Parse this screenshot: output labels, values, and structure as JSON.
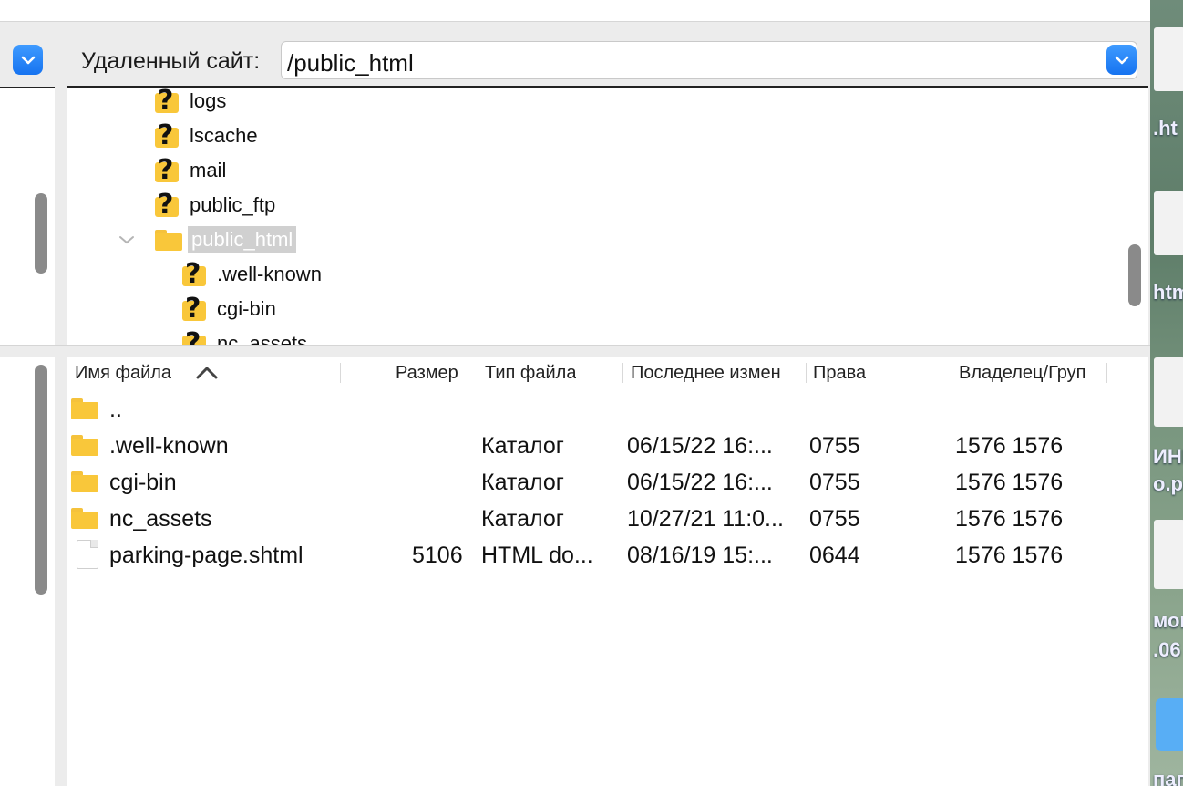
{
  "remote": {
    "site_label": "Удаленный сайт:",
    "path": "/public_html"
  },
  "tree": {
    "items": [
      {
        "label": "logs",
        "icon": "unknown-folder-icon"
      },
      {
        "label": "lscache",
        "icon": "unknown-folder-icon"
      },
      {
        "label": "mail",
        "icon": "unknown-folder-icon"
      },
      {
        "label": "public_ftp",
        "icon": "unknown-folder-icon"
      },
      {
        "label": "public_html",
        "icon": "open-folder-icon",
        "expanded": true,
        "selected": true
      },
      {
        "label": ".well-known",
        "icon": "unknown-folder-icon"
      },
      {
        "label": "cgi-bin",
        "icon": "unknown-folder-icon"
      },
      {
        "label": "nc_assets",
        "icon": "unknown-folder-icon"
      }
    ]
  },
  "list": {
    "columns": {
      "name": "Имя файла",
      "size": "Размер",
      "type": "Тип файла",
      "modified": "Последнее измен",
      "perms": "Права",
      "owner": "Владелец/Груп"
    },
    "sort_icon": "sort-ascending-chevron-icon",
    "rows": [
      {
        "name": "..",
        "size": "",
        "type": "",
        "modified": "",
        "perms": "",
        "owner": "",
        "icon": "folder-icon"
      },
      {
        "name": ".well-known",
        "size": "",
        "type": "Каталог",
        "modified": "06/15/22 16:...",
        "perms": "0755",
        "owner": "1576 1576",
        "icon": "folder-icon"
      },
      {
        "name": "cgi-bin",
        "size": "",
        "type": "Каталог",
        "modified": "06/15/22 16:...",
        "perms": "0755",
        "owner": "1576 1576",
        "icon": "folder-icon"
      },
      {
        "name": "nc_assets",
        "size": "",
        "type": "Каталог",
        "modified": "10/27/21 11:0...",
        "perms": "0755",
        "owner": "1576 1576",
        "icon": "folder-icon"
      },
      {
        "name": "parking-page.shtml",
        "size": "5106",
        "type": "HTML do...",
        "modified": "08/16/19 15:...",
        "perms": "0644",
        "owner": "1576 1576",
        "icon": "document-icon"
      }
    ]
  },
  "desktop": {
    "labels": [
      ".ht",
      "htm",
      "ИНІ",
      "o.pi",
      "мок",
      ".06",
      "пап"
    ]
  },
  "colors": {
    "accent": "#1673f0",
    "folder": "#f9c73a",
    "selection": "#d0d0d0"
  }
}
